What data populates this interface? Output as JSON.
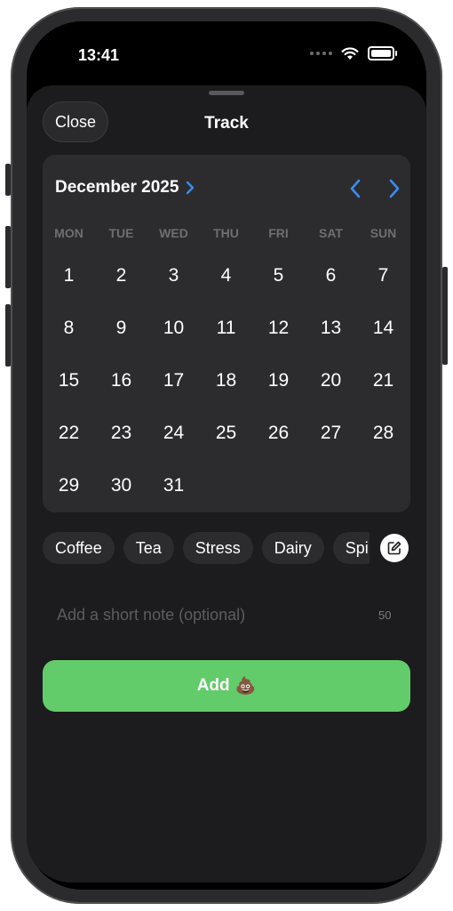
{
  "status_bar": {
    "time": "13:41"
  },
  "sheet": {
    "title": "Track",
    "close_label": "Close"
  },
  "calendar": {
    "month_label": "December 2025",
    "weekdays": [
      "MON",
      "TUE",
      "WED",
      "THU",
      "FRI",
      "SAT",
      "SUN"
    ],
    "days": [
      "1",
      "2",
      "3",
      "4",
      "5",
      "6",
      "7",
      "8",
      "9",
      "10",
      "11",
      "12",
      "13",
      "14",
      "15",
      "16",
      "17",
      "18",
      "19",
      "20",
      "21",
      "22",
      "23",
      "24",
      "25",
      "26",
      "27",
      "28",
      "29",
      "30",
      "31"
    ]
  },
  "tags": [
    "Coffee",
    "Tea",
    "Stress",
    "Dairy",
    "Spi"
  ],
  "note": {
    "placeholder": "Add a short note (optional)",
    "counter": "50"
  },
  "add_button": {
    "label": "Add",
    "emoji": "💩"
  },
  "colors": {
    "accent_blue": "#3b8cf0",
    "add_green": "#63cc6a",
    "sheet_bg": "#1c1c1e",
    "card_bg": "#2c2c2e"
  }
}
